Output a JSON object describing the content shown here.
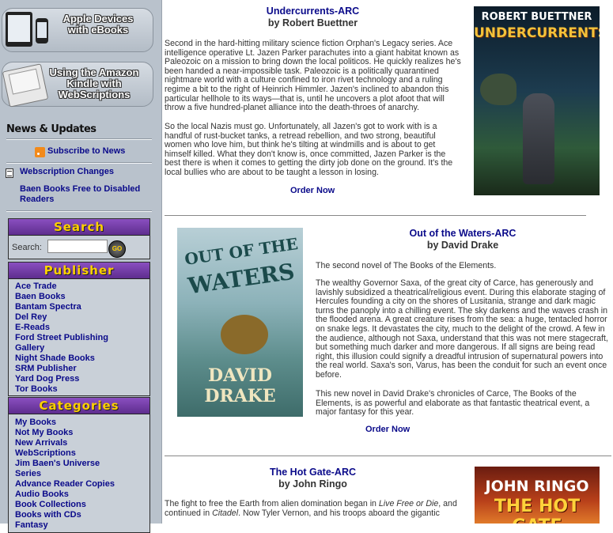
{
  "sidebar": {
    "promo_apple": "Apple Devices with eBooks",
    "promo_kindle": "Using the Amazon Kindle with WebScriptions",
    "news_heading": "News & Updates",
    "subscribe": "Subscribe to News",
    "news_links": [
      "Webscription Changes",
      "Baen Books Free to Disabled Readers"
    ],
    "search_title": "Search",
    "search_label": "Search:",
    "search_value": "",
    "go_label": "GO",
    "publisher_title": "Publisher",
    "publishers": [
      "Ace Trade",
      "Baen Books",
      "Bantam Spectra",
      "Del Rey",
      "E-Reads",
      "Ford Street Publishing",
      "Gallery",
      "Night Shade Books",
      "SRM Publisher",
      "Yard Dog Press",
      "Tor Books"
    ],
    "categories_title": "Categories",
    "categories": [
      "My Books",
      "Not My Books",
      "New Arrivals",
      "WebScriptions",
      "Jim Baen's Universe",
      "Series",
      "Advance Reader Copies",
      "Audio Books",
      "Book Collections",
      "Books with CDs",
      "Fantasy"
    ]
  },
  "items": [
    {
      "title": "Undercurrents-ARC",
      "byline": "by Robert Buettner",
      "paragraphs": [
        "Second in the hard-hitting military science fiction Orphan's Legacy series. Ace intelligence operative Lt. Jazen Parker parachutes into a giant habitat known as Paleozoic on a mission to bring down the local politicos. He quickly realizes he's been handed a near-impossible task. Paleozoic is a politically quarantined nightmare world with a culture confined to iron rivet technology and a ruling regime a bit to the right of Heinrich Himmler. Jazen's inclined to abandon this particular hellhole to its ways—that is, until he uncovers a plot afoot that will throw a five hundred-planet alliance into the death-throes of anarchy.",
        "So the local Nazis must go. Unfortunately, all Jazen's got to work with is a handful of rust-bucket tanks, a retread rebellion, and two strong, beautiful women who love him, but think he's tilting at windmills and is about to get himself killed. What they don't know is, once committed, Jazen Parker is the best there is when it comes to getting the dirty job done on the ground. It's the local bullies who are about to be taught a lesson in losing."
      ],
      "order": "Order Now",
      "cover_author": "ROBERT BUETTNER",
      "cover_title": "UNDERCURRENTS"
    },
    {
      "title": "Out of the Waters-ARC",
      "byline": "by David Drake",
      "paragraphs": [
        "The second novel of The Books of the Elements.",
        "The wealthy Governor Saxa, of the great city of Carce, has generously and lavishly subsidized a theatrical/religious event. During this elaborate staging of Hercules founding a city on the shores of Lusitania, strange and dark magic turns the panoply into a chilling event. The sky darkens and the waves crash in the flooded arena. A great creature rises from the sea: a huge, tentacled horror on snake legs. It devastates the city, much to the delight of the crowd. A few in the audience, although not Saxa, understand that this was not mere stagecraft, but something much darker and more dangerous. If all signs are being read right, this illusion could signify a dreadful intrusion of supernatural powers into the real world. Saxa's son, Varus, has been the conduit for such an event once before.",
        "This new novel in David Drake's chronicles of Carce, The Books of the Elements, is as powerful and elaborate as that fantastic theatrical event, a major fantasy for this year."
      ],
      "order": "Order Now",
      "cover_title_1": "OUT OF THE",
      "cover_title_2": "WATERS",
      "cover_author_1": "DAVID",
      "cover_author_2": "DRAKE"
    },
    {
      "title": "The Hot Gate-ARC",
      "byline": "by John Ringo",
      "para_a": "The fight to free the Earth from alien domination began in ",
      "para_em1": "Live Free or Die",
      "para_b": ", and continued in ",
      "para_em2": "Citadel",
      "para_c": ". Now Tyler Vernon, and his troops aboard the gigantic",
      "cover_author": "JOHN RINGO",
      "cover_title": "THE HOT GATE"
    }
  ],
  "colors": {
    "link": "#0a0a8a",
    "sidebar_bg": "#b9c2cc",
    "box_header": "#6a35a0",
    "box_header_text": "#ffd000"
  }
}
